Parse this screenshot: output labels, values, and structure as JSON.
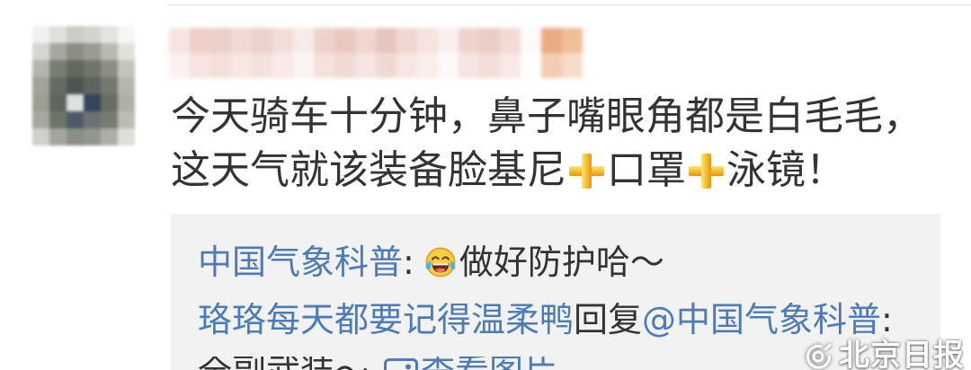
{
  "colors": {
    "text": "#333333",
    "link": "#4d7bb5",
    "reply_bg": "#f2f2f2",
    "plus_emoji": "#f6bf2a",
    "divider": "#e5e5e5",
    "watermark_text": "#ffffff"
  },
  "comment": {
    "line1": "今天骑车十分钟，鼻子嘴眼角都是白毛毛，",
    "line2": {
      "segment1": "这天气就该装备脸基尼",
      "segment2": "口罩",
      "segment3": "泳镜！"
    },
    "inline_icon": "heavy-plus-emoji-icon"
  },
  "replies": [
    {
      "author": "中国气象科普",
      "separator": ":",
      "emoji_icon": "laughing-crying-face-icon",
      "text": "做好防护哈～"
    },
    {
      "author": "珞珞每天都要记得温柔鸭",
      "reply_word": "回复",
      "mention": "@中国气象科普",
      "separator": ":",
      "text": "全副武装～",
      "image_icon": "image-icon",
      "view_image_label": "查看图片"
    }
  ],
  "watermark": {
    "logo_icon": "wechat-official-account-icon",
    "label": "北京日报"
  }
}
